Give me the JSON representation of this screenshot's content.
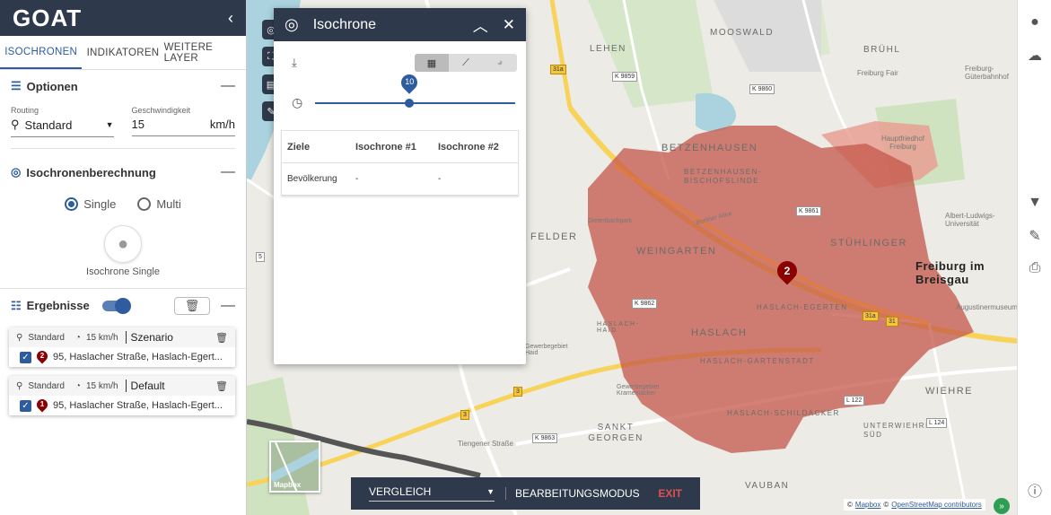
{
  "app": {
    "logo": "GOAT"
  },
  "sidebar": {
    "collapse_icon": "chevron-left-icon",
    "tabs": [
      {
        "label": "ISOCHRONEN",
        "active": true
      },
      {
        "label": "INDIKATOREN",
        "active": false
      },
      {
        "label": "WEITERE LAYER",
        "active": false
      }
    ],
    "options": {
      "title": "Optionen",
      "routing_label": "Routing",
      "routing_value": "Standard",
      "speed_label": "Geschwindigkeit",
      "speed_value": "15",
      "speed_unit": "km/h"
    },
    "calculation": {
      "title": "Isochronenberechnung",
      "single_label": "Single",
      "multi_label": "Multi",
      "selected": "Single",
      "single_button_label": "Isochrone Single"
    },
    "results": {
      "title": "Ergebnisse",
      "items": [
        {
          "mode_label": "Standard",
          "speed": "15 km/h",
          "type": "Szenario",
          "number": "2",
          "address": "95, Haslacher Straße, Haslach-Egert..."
        },
        {
          "mode_label": "Standard",
          "speed": "15 km/h",
          "type": "Default",
          "number": "1",
          "address": "95, Haslacher Straße, Haslach-Egert..."
        }
      ]
    }
  },
  "iso_panel": {
    "title": "Isochrone",
    "slider_value": "10",
    "table": {
      "headers": [
        "Ziele",
        "Isochrone #1",
        "Isochrone #2"
      ],
      "rows": [
        [
          "Bevölkerung",
          "-",
          "-"
        ]
      ]
    }
  },
  "bottom_bar": {
    "compare_label": "VERGLEICH",
    "edit_mode_label": "BEARBEITUNGSMODUS",
    "exit_label": "EXIT"
  },
  "map": {
    "marker_number": "2",
    "basemap_label": "Mapbox",
    "attribution_prefix": "©",
    "attribution_mapbox": "Mapbox",
    "attribution_sep": "©",
    "attribution_osm": "OpenStreetMap contributors",
    "place_labels": {
      "lehen": "LEHEN",
      "mooswald": "MOOSWALD",
      "bruhl": "BRÜHL",
      "betzenhausen": "BETZENHAUSEN",
      "betzenhausen_bischofslinde": "BETZENHAUSEN-BISCHOFSLINDE",
      "stuhlinger": "STÜHLINGER",
      "weingarten": "WEINGARTEN",
      "freiburg": "Freiburg im Breisgau",
      "haslach": "HASLACH",
      "haslach_egerten": "HASLACH-EGERTEN",
      "haslach_gartenstadt": "HASLACH-GARTENSTADT",
      "haslach_schildacker": "HASLACH-SCHILDACKER",
      "wiehre": "WIEHRE",
      "sankt_georgen": "SANKT GEORGEN",
      "vauban": "VAUBAN",
      "unterwiehre_sud": "UNTERWIEHRE-SÜD",
      "felder": "FELDER",
      "haslach_haid": "HASLACH-HAID",
      "gewerbe_haid": "Gewerbegebiet Haid",
      "gewerbe_kramer": "Gewerbegebiet Kramemacker",
      "dietenbachpark": "Dietenbachpark",
      "freiburg_fair": "Freiburg Fair",
      "hauptfriedhof": "Hauptfriedhof Freiburg",
      "gueterbahnhof": "Freiburg-Güterbahnhof",
      "uni": "Albert-Ludwigs-Universität",
      "augustiner": "Augustinermuseum",
      "tiengener": "Tiengener Straße",
      "berliner": "Berliner Allee"
    },
    "road_badges": {
      "k9859": "K 9859",
      "k9860": "K 9860",
      "k9863": "K 9863",
      "k9862": "K 9862",
      "k9861": "K 9861",
      "l122": "L 122",
      "l124": "L 124",
      "b3a": "3",
      "b3b": "3",
      "b31a": "31a",
      "b31b": "31a",
      "b31": "31",
      "b5": "5"
    }
  }
}
